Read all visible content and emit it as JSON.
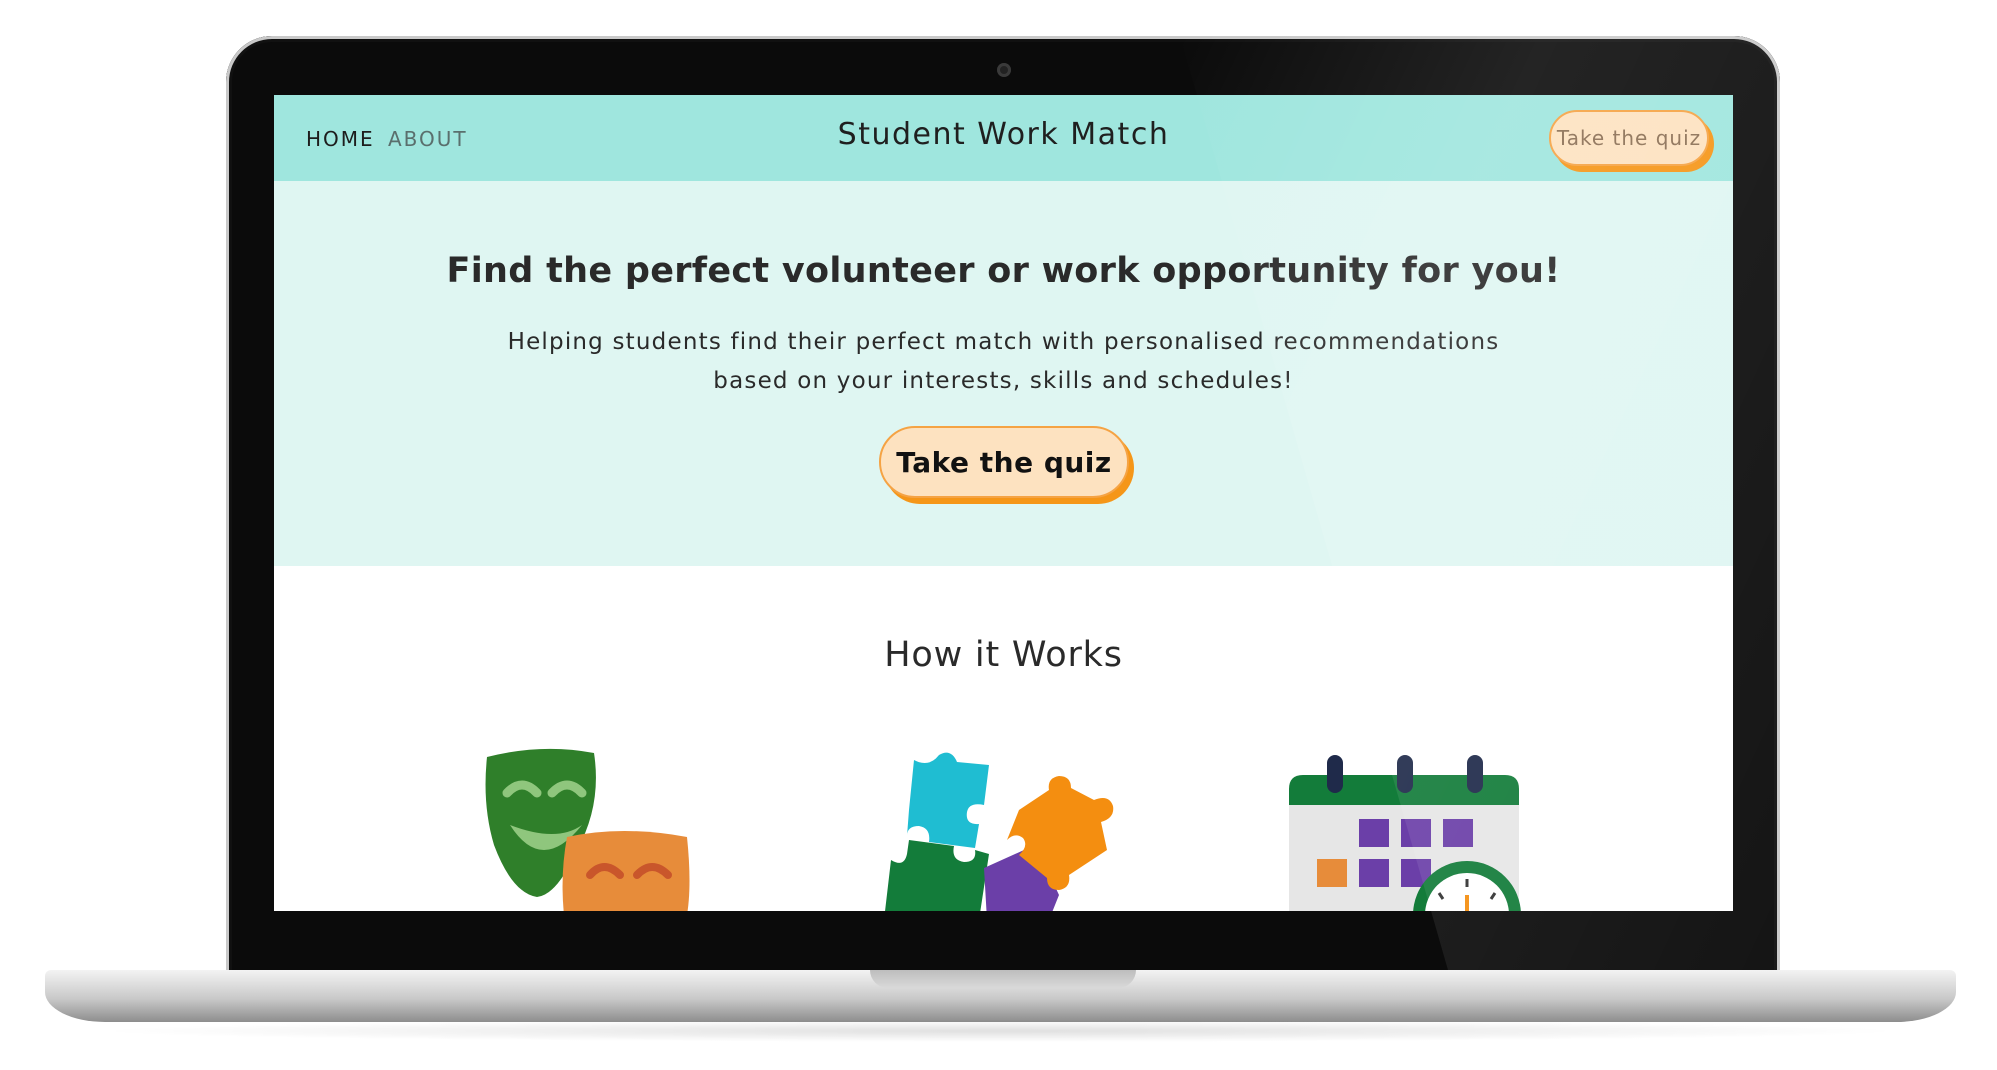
{
  "nav": {
    "home": "HOME",
    "about": "ABOUT",
    "title": "Student Work Match",
    "cta": "Take the quiz"
  },
  "hero": {
    "heading": "Find the perfect volunteer or work opportunity for you!",
    "subtext": "Helping students find their perfect match with personalised recommendations based on your interests, skills and schedules!",
    "cta": "Take the quiz"
  },
  "how_it_works": {
    "heading": "How it Works",
    "icons": [
      "theatre-masks-icon",
      "puzzle-pieces-icon",
      "calendar-clock-icon"
    ]
  },
  "colors": {
    "navbar": "#9fe6de",
    "hero_bg": "#dff6f2",
    "button_fill": "#fde2c0",
    "button_shadow": "#f59618"
  }
}
